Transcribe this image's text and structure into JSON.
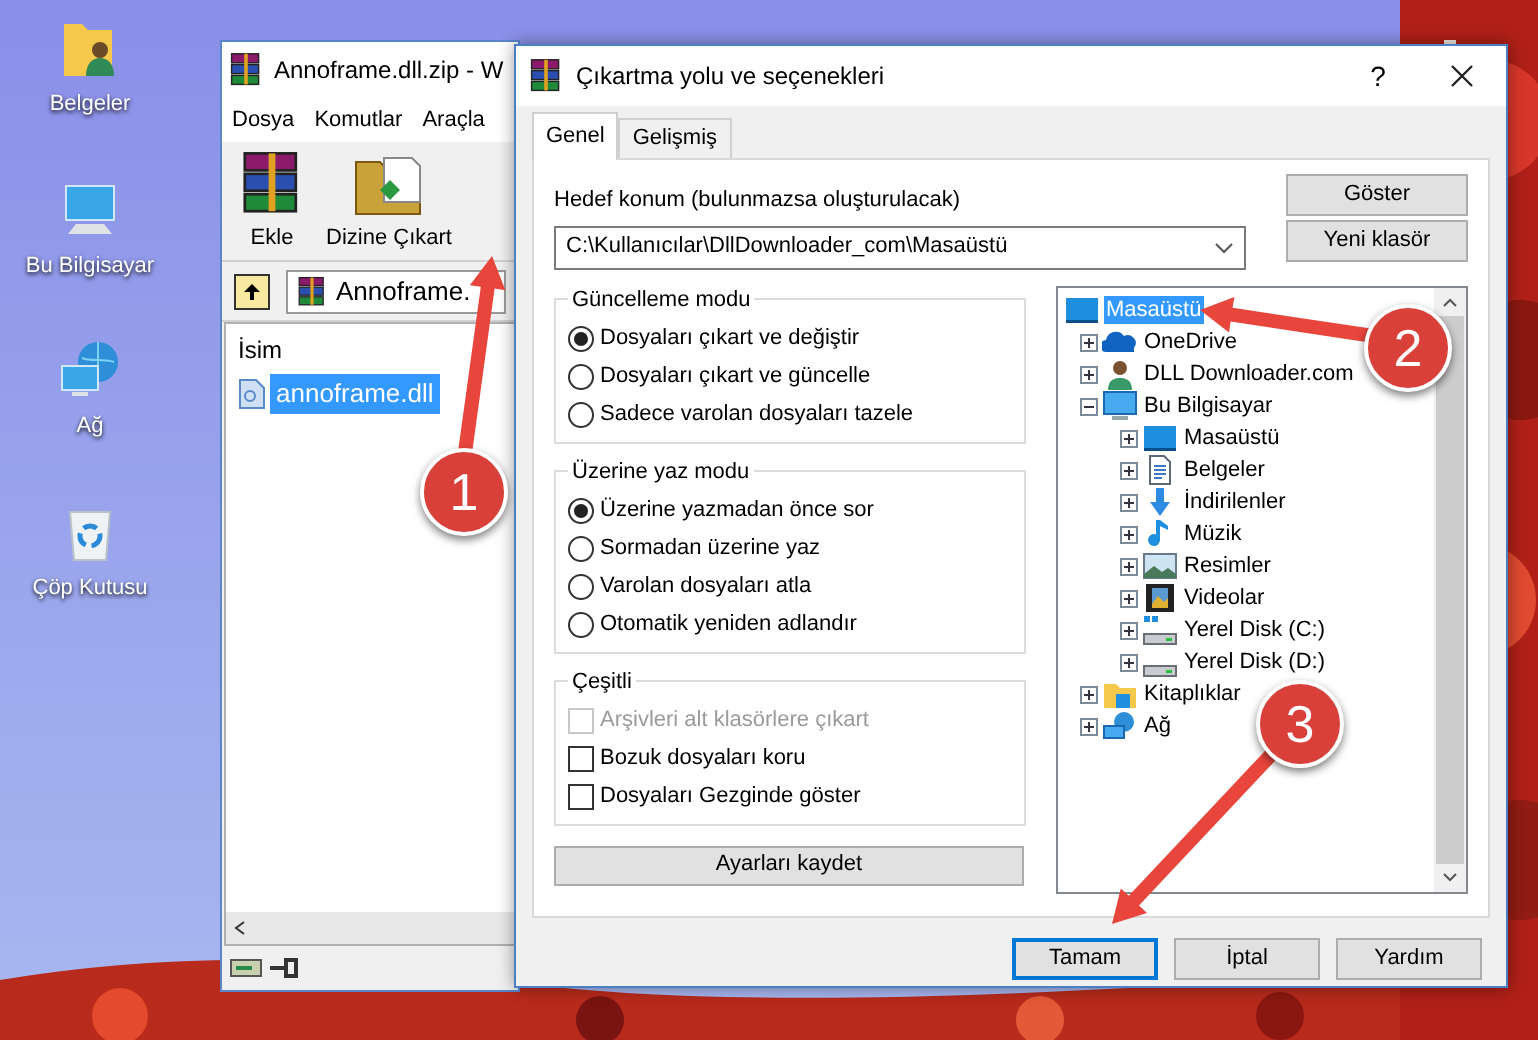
{
  "desktop_icons": [
    {
      "label": "Belgeler",
      "kind": "folder"
    },
    {
      "label": "Bu Bilgisayar",
      "kind": "computer"
    },
    {
      "label": "Ağ",
      "kind": "network"
    },
    {
      "label": "Çöp Kutusu",
      "kind": "recycle"
    }
  ],
  "archive_window": {
    "title": "Annoframe.dll.zip - W",
    "menu": [
      "Dosya",
      "Komutlar",
      "Araçla"
    ],
    "toolbar": [
      {
        "label": "Ekle",
        "kind": "add"
      },
      {
        "label": "Dizine Çıkart",
        "kind": "extract"
      }
    ],
    "address": "Annoframe.",
    "column": "İsim",
    "files": [
      {
        "name": "annoframe.dll",
        "selected": true
      }
    ]
  },
  "dialog": {
    "title": "Çıkartma yolu ve seçenekleri",
    "help": "?",
    "tabs": [
      {
        "label": "Genel",
        "selected": true
      },
      {
        "label": "Gelişmiş",
        "selected": false
      }
    ],
    "destination_label": "Hedef konum (bulunmazsa oluşturulacak)",
    "destination": "C:\\Kullanıcılar\\DllDownloader_com\\Masaüstü",
    "side_buttons": [
      "Göster",
      "Yeni klasör"
    ],
    "groups": [
      {
        "title": "Güncelleme modu",
        "kind": "radio",
        "options": [
          {
            "label": "Dosyaları çıkart ve değiştir",
            "selected": true
          },
          {
            "label": "Dosyaları çıkart ve güncelle",
            "selected": false
          },
          {
            "label": "Sadece varolan dosyaları tazele",
            "selected": false
          }
        ]
      },
      {
        "title": "Üzerine yaz modu",
        "kind": "radio",
        "options": [
          {
            "label": "Üzerine yazmadan önce sor",
            "selected": true
          },
          {
            "label": "Sormadan üzerine yaz",
            "selected": false
          },
          {
            "label": "Varolan dosyaları atla",
            "selected": false
          },
          {
            "label": "Otomatik yeniden adlandır",
            "selected": false
          }
        ]
      },
      {
        "title": "Çeşitli",
        "kind": "checkbox",
        "options": [
          {
            "label": "Arşivleri alt klasörlere çıkart",
            "checked": false,
            "disabled": true
          },
          {
            "label": "Bozuk dosyaları koru",
            "checked": false,
            "disabled": false
          },
          {
            "label": "Dosyaları Gezginde göster",
            "checked": false,
            "disabled": false
          }
        ]
      }
    ],
    "save_button": "Ayarları kaydet",
    "tree": {
      "label": "Masaüstü",
      "kind": "desktop",
      "selected": true,
      "children": [
        {
          "label": "OneDrive",
          "kind": "cloud",
          "selected": false,
          "expanded": false
        },
        {
          "label": "DLL Downloader.com",
          "kind": "user",
          "selected": false,
          "expanded": false
        },
        {
          "label": "Bu Bilgisayar",
          "kind": "computer",
          "selected": false,
          "expanded": true,
          "children": [
            {
              "label": "Masaüstü",
              "kind": "desktop",
              "selected": false,
              "expanded": false
            },
            {
              "label": "Belgeler",
              "kind": "documents",
              "selected": false,
              "expanded": false
            },
            {
              "label": "İndirilenler",
              "kind": "downloads",
              "selected": false,
              "expanded": false
            },
            {
              "label": "Müzik",
              "kind": "music",
              "selected": false,
              "expanded": false
            },
            {
              "label": "Resimler",
              "kind": "pictures",
              "selected": false,
              "expanded": false
            },
            {
              "label": "Videolar",
              "kind": "videos",
              "selected": false,
              "expanded": false
            },
            {
              "label": "Yerel Disk (C:)",
              "kind": "system-disk",
              "selected": false,
              "expanded": false
            },
            {
              "label": "Yerel Disk (D:)",
              "kind": "disk",
              "selected": false,
              "expanded": false
            }
          ]
        },
        {
          "label": "Kitaplıklar",
          "kind": "library",
          "selected": false,
          "expanded": false
        },
        {
          "label": "Ağ",
          "kind": "network",
          "selected": false,
          "expanded": false
        }
      ]
    },
    "footer_buttons": [
      {
        "label": "Tamam",
        "default": true
      },
      {
        "label": "İptal",
        "default": false
      },
      {
        "label": "Yardım",
        "default": false
      }
    ]
  },
  "annotations": [
    {
      "number": "1"
    },
    {
      "number": "2"
    },
    {
      "number": "3"
    }
  ]
}
